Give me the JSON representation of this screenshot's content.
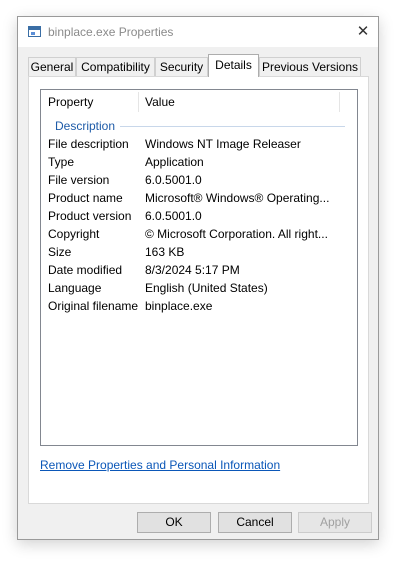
{
  "window": {
    "title": "binplace.exe Properties",
    "close_symbol": "✕"
  },
  "tabs": [
    {
      "label": "General"
    },
    {
      "label": "Compatibility"
    },
    {
      "label": "Security"
    },
    {
      "label": "Details",
      "active": true
    },
    {
      "label": "Previous Versions"
    }
  ],
  "details": {
    "columns": {
      "property": "Property",
      "value": "Value"
    },
    "group": "Description",
    "rows": [
      {
        "property": "File description",
        "value": "Windows NT Image Releaser"
      },
      {
        "property": "Type",
        "value": "Application"
      },
      {
        "property": "File version",
        "value": "6.0.5001.0"
      },
      {
        "property": "Product name",
        "value": "Microsoft® Windows® Operating..."
      },
      {
        "property": "Product version",
        "value": "6.0.5001.0"
      },
      {
        "property": "Copyright",
        "value": "© Microsoft Corporation. All right..."
      },
      {
        "property": "Size",
        "value": "163 KB"
      },
      {
        "property": "Date modified",
        "value": "8/3/2024 5:17 PM"
      },
      {
        "property": "Language",
        "value": "English (United States)"
      },
      {
        "property": "Original filename",
        "value": "binplace.exe"
      }
    ]
  },
  "remove_link": "Remove Properties and Personal Information",
  "buttons": {
    "ok": "OK",
    "cancel": "Cancel",
    "apply": "Apply"
  },
  "colors": {
    "group_header": "#1e5ba8",
    "link": "#0b57b8"
  }
}
